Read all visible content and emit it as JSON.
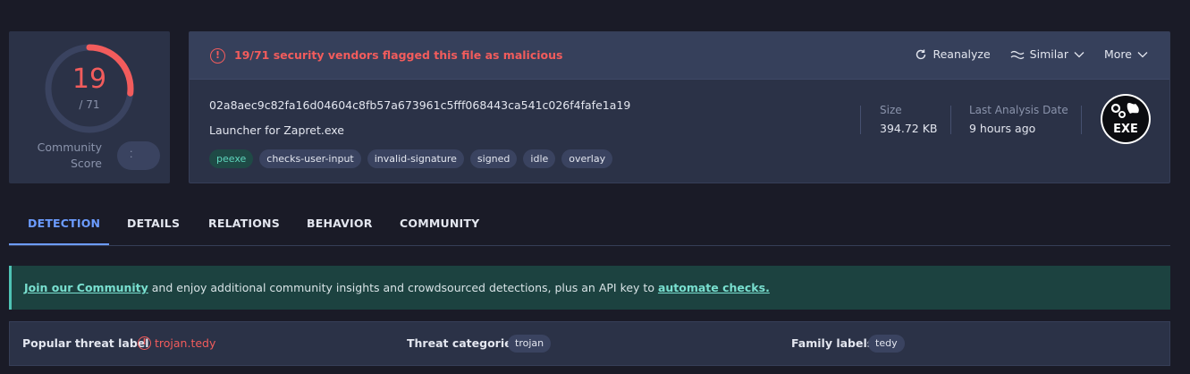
{
  "score": {
    "detections": "19",
    "total": "/ 71",
    "fraction": 0.268,
    "community_label_line1": "Community",
    "community_label_line2": "Score",
    "accent": "#f25c5c"
  },
  "alert": {
    "text": "19/71 security vendors flagged this file as malicious",
    "icon": "alert-circle-icon"
  },
  "actions": {
    "reanalyze": "Reanalyze",
    "similar": "Similar",
    "more": "More"
  },
  "file": {
    "hash": "02a8aec9c82fa16d04604c8fb57a673961c5fff068443ca541c026f4fafe1a19",
    "name": "Launcher for Zapret.exe",
    "tags": [
      "peexe",
      "checks-user-input",
      "invalid-signature",
      "signed",
      "idle",
      "overlay"
    ],
    "size_label": "Size",
    "size_value": "394.72 KB",
    "date_label": "Last Analysis Date",
    "date_value": "9 hours ago",
    "type_badge": "EXE"
  },
  "tabs": [
    "DETECTION",
    "DETAILS",
    "RELATIONS",
    "BEHAVIOR",
    "COMMUNITY"
  ],
  "banner": {
    "link1": "Join our Community",
    "middle": " and enjoy additional community insights and crowdsourced detections, plus an API key to ",
    "link2": "automate checks."
  },
  "threat": {
    "popular_label": "Popular threat label",
    "popular_value": "trojan.tedy",
    "categories_label": "Threat categories",
    "categories_value": "trojan",
    "family_label": "Family labels",
    "family_value": "tedy"
  }
}
